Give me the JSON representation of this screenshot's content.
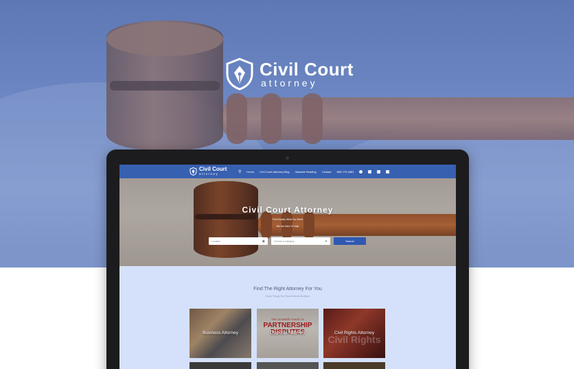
{
  "brand": {
    "title": "Civil Court",
    "subtitle": "attorney"
  },
  "site": {
    "nav": {
      "logo_title": "Civil Court",
      "logo_sub": "attorney",
      "items": [
        "Home",
        "Civil Court Attorney Blog",
        "Valuable Reading",
        "Contact"
      ],
      "phone": "866-779-4881",
      "icons": [
        "search-icon",
        "facebook-icon",
        "twitter-icon",
        "instagram-icon",
        "linkedin-icon"
      ]
    },
    "hero": {
      "title": "Civil Court Attorney",
      "sub1": "Find Exactly What You Need",
      "sub2": "We Are Here To Help",
      "location_placeholder": "Location",
      "category_placeholder": "Choose a category...",
      "search_label": "Search"
    },
    "section": {
      "title": "Find The Right Attorney For You",
      "subtitle": "Some Things You Should Never Be Alone"
    },
    "cards": [
      {
        "label": "Business Attorney"
      },
      {
        "label": "Disputes Attorney",
        "image_text_small": "THE ULTIMATE GUIDE TO",
        "image_text": "PARTNERSHIP DISPUTES"
      },
      {
        "label": "Civil Rights Attorney",
        "image_text": "Civil Rights"
      }
    ]
  },
  "colors": {
    "hero_overlay": "#6b86c2",
    "nav_blue": "#3760b1",
    "section_bg": "#d5e1fb",
    "button_blue": "#2f58b0"
  }
}
